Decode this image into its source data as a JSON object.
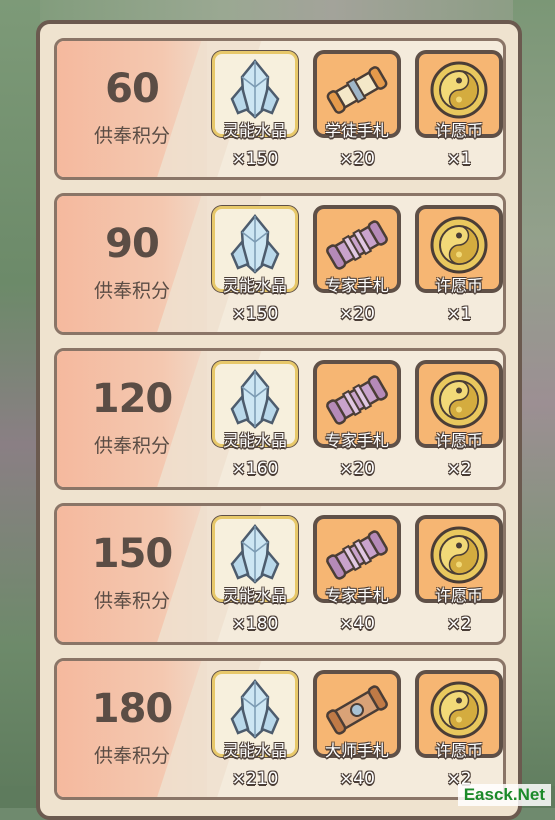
{
  "rows": [
    {
      "points": "60",
      "points_label": "供奉积分",
      "items": [
        {
          "name": "灵能水晶",
          "qty": "×150",
          "icon": "crystal-icon",
          "box": "cream"
        },
        {
          "name": "学徒手札",
          "qty": "×20",
          "icon": "apprentice-scroll-icon",
          "box": "orange"
        },
        {
          "name": "许愿币",
          "qty": "×1",
          "icon": "wish-coin-icon",
          "box": "orange"
        }
      ]
    },
    {
      "points": "90",
      "points_label": "供奉积分",
      "items": [
        {
          "name": "灵能水晶",
          "qty": "×150",
          "icon": "crystal-icon",
          "box": "cream"
        },
        {
          "name": "专家手札",
          "qty": "×20",
          "icon": "expert-scroll-icon",
          "box": "orange"
        },
        {
          "name": "许愿币",
          "qty": "×1",
          "icon": "wish-coin-icon",
          "box": "orange"
        }
      ]
    },
    {
      "points": "120",
      "points_label": "供奉积分",
      "items": [
        {
          "name": "灵能水晶",
          "qty": "×160",
          "icon": "crystal-icon",
          "box": "cream"
        },
        {
          "name": "专家手札",
          "qty": "×20",
          "icon": "expert-scroll-icon",
          "box": "orange"
        },
        {
          "name": "许愿币",
          "qty": "×2",
          "icon": "wish-coin-icon",
          "box": "orange"
        }
      ]
    },
    {
      "points": "150",
      "points_label": "供奉积分",
      "items": [
        {
          "name": "灵能水晶",
          "qty": "×180",
          "icon": "crystal-icon",
          "box": "cream"
        },
        {
          "name": "专家手札",
          "qty": "×40",
          "icon": "expert-scroll-icon",
          "box": "orange"
        },
        {
          "name": "许愿币",
          "qty": "×2",
          "icon": "wish-coin-icon",
          "box": "orange"
        }
      ]
    },
    {
      "points": "180",
      "points_label": "供奉积分",
      "items": [
        {
          "name": "灵能水晶",
          "qty": "×210",
          "icon": "crystal-icon",
          "box": "cream"
        },
        {
          "name": "大师手札",
          "qty": "×40",
          "icon": "master-scroll-icon",
          "box": "orange"
        },
        {
          "name": "许愿币",
          "qty": "×2",
          "icon": "wish-coin-icon",
          "box": "orange"
        }
      ]
    }
  ],
  "watermark": "Easck.Net",
  "colors": {
    "panel_bg": "#efe3cf",
    "row_left_bg": "#f5b99e",
    "item_orange": "#f6b673",
    "border_dark": "#5f5047",
    "crystal": "#b9d8ea",
    "apprentice_scroll": "#e59a4b",
    "expert_scroll": "#b58ab8",
    "master_scroll": "#c07a46",
    "coin": "#e9c85e"
  }
}
